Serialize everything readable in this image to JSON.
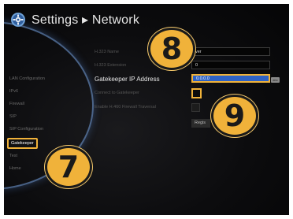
{
  "header": {
    "title": "Settings ▸ Network",
    "icon": "gear-icon"
  },
  "sidebar": {
    "items": [
      {
        "label": "LAN Configuration",
        "active": false
      },
      {
        "label": "IPv6",
        "active": false
      },
      {
        "label": "Firewall",
        "active": false
      },
      {
        "label": "SIP",
        "active": false
      },
      {
        "label": "SIP Configuration",
        "active": false
      },
      {
        "label": "Gatekeeper",
        "active": true
      },
      {
        "label": "Test",
        "active": false
      },
      {
        "label": "Home",
        "active": false
      }
    ]
  },
  "form": {
    "h323_name": {
      "label": "H.323 Name",
      "value": "ver"
    },
    "h323_extension": {
      "label": "H.323 Extension",
      "value": "0"
    },
    "gatekeeper_ip": {
      "label": "Gatekeeper IP Address",
      "value": "0.0.0.0",
      "keyboard_badge": "abc"
    },
    "connect_gatekeeper": {
      "label": "Connect to Gatekeeper"
    },
    "h460": {
      "label": "Enable H.460 Firewall Traversal"
    },
    "register_button": {
      "label": "Regis"
    }
  },
  "callouts": [
    "7",
    "8",
    "9"
  ],
  "colors": {
    "accent": "#f0b23a",
    "selection": "#2d62c5",
    "background": "#0c0c0e"
  }
}
